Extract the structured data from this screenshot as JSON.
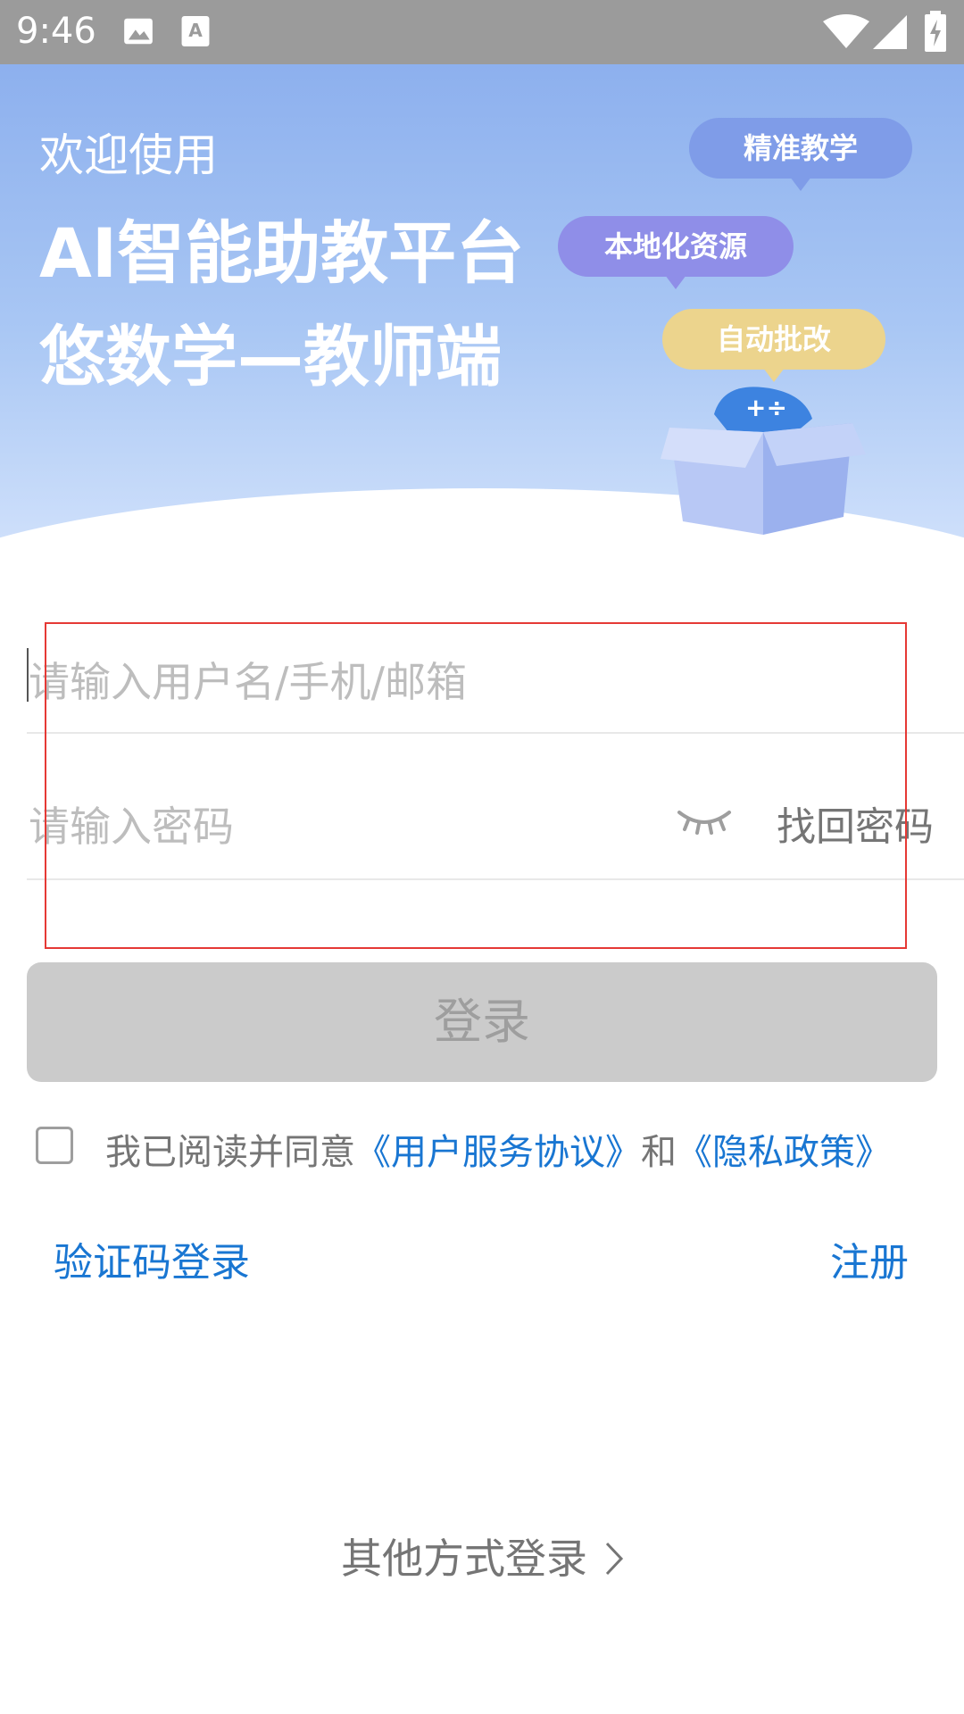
{
  "status_bar": {
    "time": "9:46",
    "icons": [
      "image-icon",
      "a-text-icon",
      "wifi-icon",
      "signal-icon",
      "battery-charging-icon"
    ]
  },
  "hero": {
    "welcome": "欢迎使用",
    "title_line1": "AI智能助教平台",
    "title_line2": "悠数学—教师端",
    "bubbles": [
      "精准教学",
      "本地化资源",
      "自动批改"
    ],
    "colors": {
      "bubble1": "#7f9ce8",
      "bubble2": "#8f8ee8",
      "bubble3": "#ecd48d"
    }
  },
  "form": {
    "username_placeholder": "请输入用户名/手机/邮箱",
    "password_placeholder": "请输入密码",
    "forgot_password": "找回密码",
    "login_button": "登录"
  },
  "agreement": {
    "prefix": "我已阅读并同意",
    "terms": "《用户服务协议》",
    "and": "和",
    "privacy": "《隐私政策》",
    "checked": false
  },
  "links": {
    "code_login": "验证码登录",
    "register": "注册",
    "other_login": "其他方式登录"
  },
  "colors": {
    "link": "#1976d2",
    "highlight_box": "#e53935"
  }
}
